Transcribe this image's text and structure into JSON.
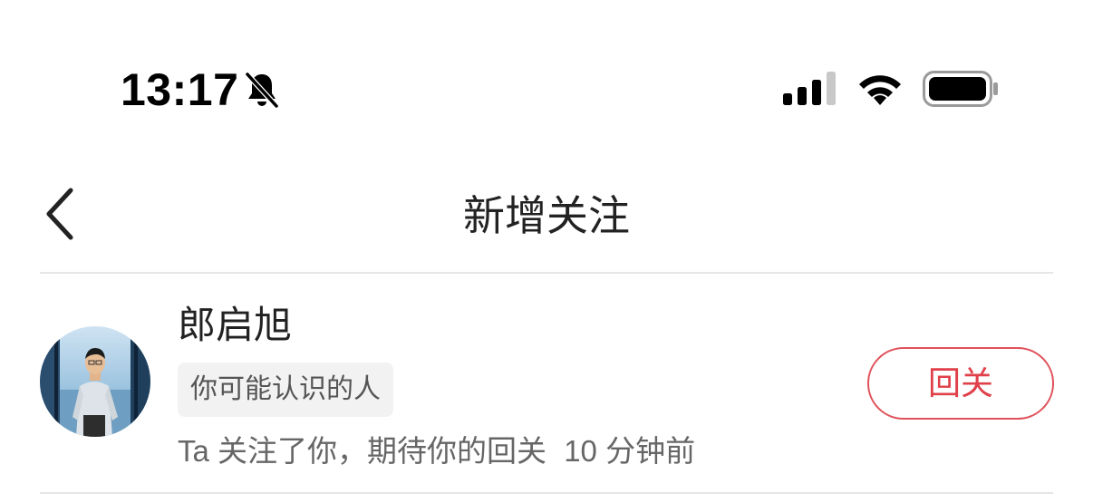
{
  "status_bar": {
    "time": "13:17",
    "icons": [
      "bell-slash-icon",
      "cellular-signal-icon",
      "wifi-icon",
      "battery-icon"
    ]
  },
  "nav": {
    "title": "新增关注",
    "back_icon": "chevron-left-icon"
  },
  "followers": [
    {
      "name": "郎启旭",
      "tag": "你可能认识的人",
      "message": "Ta 关注了你，期待你的回关",
      "time": "10 分钟前",
      "action_label": "回关"
    }
  ],
  "colors": {
    "accent": "#e0404a",
    "text_primary": "#222222",
    "text_secondary": "#666666",
    "tag_bg": "#f2f2f2",
    "divider": "#e6e6e6"
  }
}
